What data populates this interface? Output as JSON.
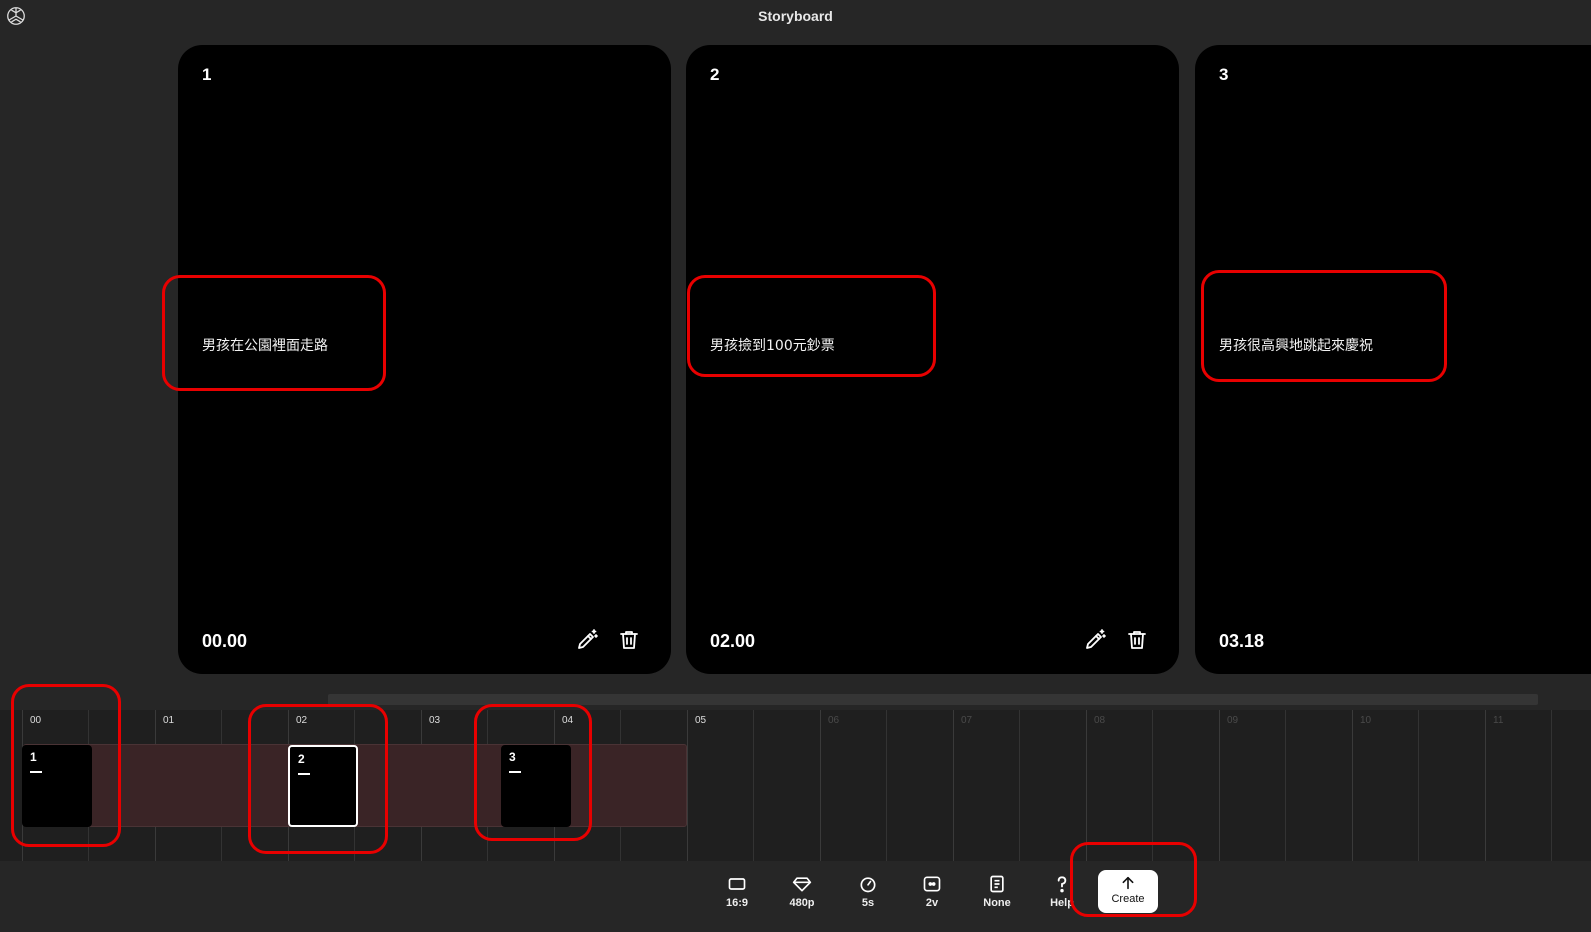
{
  "header": {
    "title": "Storyboard",
    "logo_icon": "openai-logo-icon"
  },
  "cards": [
    {
      "number": "1",
      "caption": "男孩在公園裡面走路",
      "time": "00.00"
    },
    {
      "number": "2",
      "caption": "男孩撿到100元鈔票",
      "time": "02.00"
    },
    {
      "number": "3",
      "caption": "男孩很高興地跳起來慶祝",
      "time": "03.18"
    }
  ],
  "card_actions": {
    "edit_icon": "magic-pencil-icon",
    "delete_icon": "trash-icon"
  },
  "timeline": {
    "ticks": [
      "00",
      "01",
      "02",
      "03",
      "04",
      "05",
      "06",
      "07",
      "08",
      "09",
      "10",
      "11"
    ],
    "clips": [
      {
        "number": "1",
        "selected": false
      },
      {
        "number": "2",
        "selected": true
      },
      {
        "number": "3",
        "selected": false
      }
    ]
  },
  "toolbar": {
    "aspect": "16:9",
    "resolution": "480p",
    "duration": "5s",
    "variations": "2v",
    "preset": "None",
    "help": "Help",
    "create": "Create"
  },
  "colors": {
    "annotation": "#e80000",
    "background": "#262626",
    "card": "#000000"
  }
}
